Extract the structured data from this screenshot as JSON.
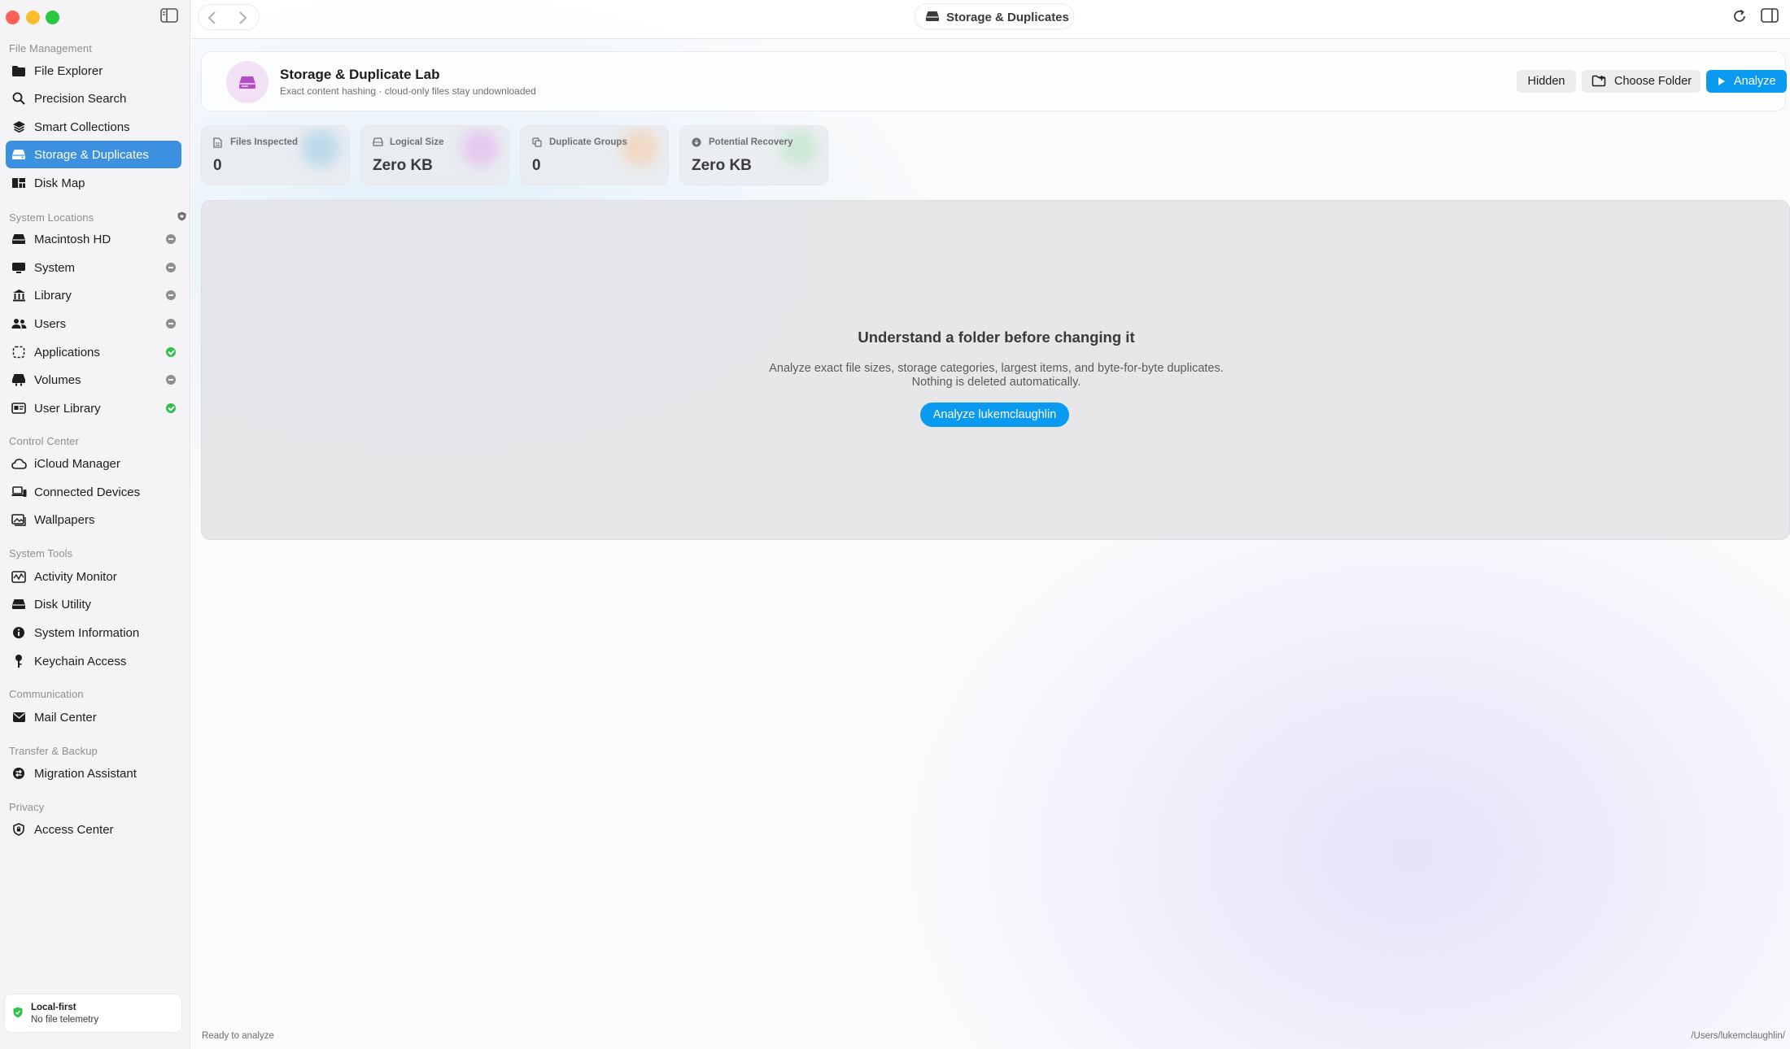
{
  "window": {
    "title": "Storage & Duplicates"
  },
  "sidebar": {
    "sections": {
      "file_management": "File Management",
      "system_locations": "System Locations",
      "control_center": "Control Center",
      "system_tools": "System Tools",
      "communication": "Communication",
      "transfer_backup": "Transfer & Backup",
      "privacy": "Privacy"
    },
    "items": {
      "file_explorer": "File Explorer",
      "precision_search": "Precision Search",
      "smart_collections": "Smart Collections",
      "storage_duplicates": "Storage & Duplicates",
      "disk_map": "Disk Map",
      "macintosh_hd": "Macintosh HD",
      "system": "System",
      "library": "Library",
      "users": "Users",
      "applications": "Applications",
      "volumes": "Volumes",
      "user_library": "User Library",
      "icloud_manager": "iCloud Manager",
      "connected_devices": "Connected Devices",
      "wallpapers": "Wallpapers",
      "activity_monitor": "Activity Monitor",
      "disk_utility": "Disk Utility",
      "system_information": "System Information",
      "keychain_access": "Keychain Access",
      "mail_center": "Mail Center",
      "migration_assistant": "Migration Assistant",
      "access_center": "Access Center"
    },
    "selected": "storage_duplicates",
    "location_status": {
      "macintosh_hd": "restricted",
      "system": "restricted",
      "library": "restricted",
      "users": "restricted",
      "applications": "allowed",
      "volumes": "restricted",
      "user_library": "allowed"
    },
    "footer": {
      "title": "Local-first",
      "subtitle": "No file telemetry"
    }
  },
  "header": {
    "title": "Storage & Duplicate Lab",
    "subtitle": "Exact content hashing · cloud-only files stay undownloaded",
    "hidden_label": "Hidden",
    "choose_folder_label": "Choose Folder",
    "analyze_label": "Analyze"
  },
  "stats": [
    {
      "label": "Files Inspected",
      "value": "0",
      "icon": "document-icon",
      "glow": "#bcd9ea"
    },
    {
      "label": "Logical Size",
      "value": "Zero KB",
      "icon": "drive-icon",
      "glow": "#e6c8ee"
    },
    {
      "label": "Duplicate Groups",
      "value": "0",
      "icon": "copy-icon",
      "glow": "#f0d8c4"
    },
    {
      "label": "Potential Recovery",
      "value": "Zero KB",
      "icon": "download-icon",
      "glow": "#cce8d4"
    }
  ],
  "empty_state": {
    "title": "Understand a folder before changing it",
    "line1": "Analyze exact file sizes, storage categories, largest items, and byte-for-byte duplicates.",
    "line2": "Nothing is deleted automatically.",
    "button_label": "Analyze lukemclaughlin"
  },
  "status_bar": {
    "left": "Ready to analyze",
    "right": "/Users/lukemclaughlin/"
  },
  "colors": {
    "accent": "#0a9af0",
    "selection": "#3b90e0",
    "allowed": "#30c04f",
    "restricted": "#8e8e93"
  }
}
